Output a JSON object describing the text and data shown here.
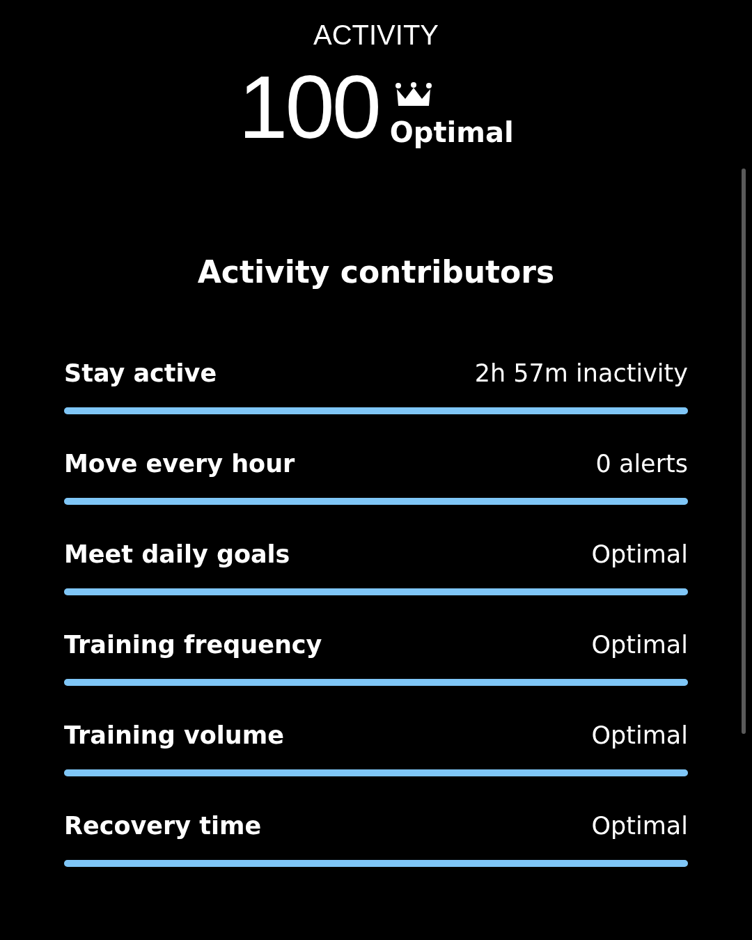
{
  "header": {
    "title": "ACTIVITY"
  },
  "score": {
    "value": "100",
    "label": "Optimal"
  },
  "section_title": "Activity contributors",
  "contributors": [
    {
      "name": "Stay active",
      "reading": "2h 57m inactivity",
      "level": 1
    },
    {
      "name": "Move every hour",
      "reading": "0 alerts",
      "level": 1
    },
    {
      "name": "Meet daily goals",
      "reading": "Optimal",
      "level": 1
    },
    {
      "name": "Training frequency",
      "reading": "Optimal",
      "level": 1
    },
    {
      "name": "Training volume",
      "reading": "Optimal",
      "level": 1
    },
    {
      "name": "Recovery time",
      "reading": "Optimal",
      "level": 1
    }
  ]
}
